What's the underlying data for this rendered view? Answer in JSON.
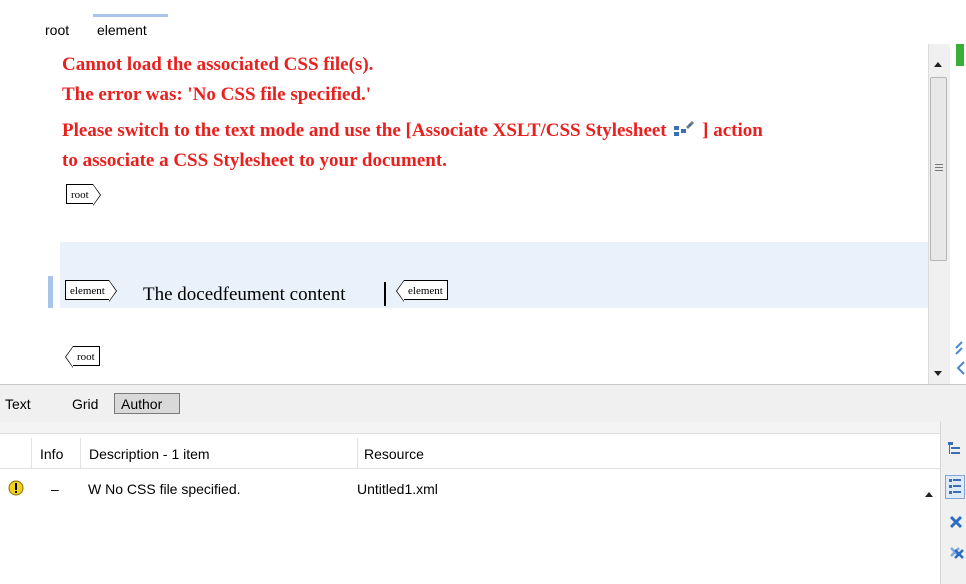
{
  "breadcrumb": {
    "items": [
      "root",
      "element"
    ]
  },
  "editor": {
    "errors": [
      "Cannot load the associated CSS file(s).",
      "The error was: 'No CSS file specified.'",
      "Please switch to the text mode and use the [Associate XSLT/CSS Stylesheet",
      "] action",
      "to associate a CSS Stylesheet to your document."
    ],
    "tags": {
      "root_open": "root",
      "element_open": "element",
      "element_close": "element",
      "root_close": "root"
    },
    "element_text": "The docedfeument content"
  },
  "mode_tabs": {
    "text": "Text",
    "grid": "Grid",
    "author": "Author",
    "active": "Author"
  },
  "problems": {
    "columns": {
      "info": "Info",
      "description": "Description - 1 item",
      "resource": "Resource"
    },
    "rows": [
      {
        "severity": "warning",
        "marker": "–",
        "description": "W No CSS file specified.",
        "resource": "Untitled1.xml"
      }
    ]
  },
  "colors": {
    "error": "#e8211f",
    "highlight": "#e9f1fa",
    "accent": "#a9c4ea",
    "green": "#38b038",
    "warning": "#f2d21f"
  },
  "icons": [
    "associate-stylesheet-icon",
    "warning-icon",
    "scroll-up-icon",
    "scroll-down-icon",
    "collapse-all-icon",
    "expand-all-icon",
    "remove-icon",
    "remove-all-icon"
  ]
}
